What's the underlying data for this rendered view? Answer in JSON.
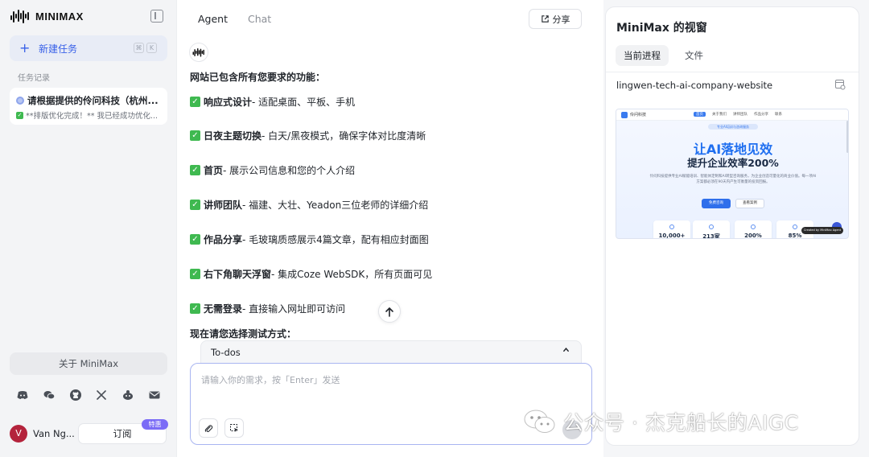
{
  "brand": {
    "name": "MINIMAX"
  },
  "sidebar": {
    "new_task": "新建任务",
    "shortcut_keys": [
      "⌘",
      "K"
    ],
    "section_title": "任务记录",
    "tasks": [
      {
        "title": "请根据提供的伶问科技（杭州...",
        "subtitle": "**排版优化完成！** 我已经成功优化..."
      }
    ],
    "about": "关于 MiniMax",
    "socials": [
      "discord-icon",
      "wechat-icon",
      "github-icon",
      "x-icon",
      "reddit-icon",
      "mail-icon"
    ],
    "user": {
      "initial": "V",
      "name": "Van Ng..."
    },
    "subscribe": "订阅",
    "badge": "特惠"
  },
  "main": {
    "tabs": [
      {
        "label": "Agent"
      },
      {
        "label": "Chat"
      }
    ],
    "share_label": "分享",
    "message": {
      "heading": "网站已包含所有您要求的功能：",
      "features": [
        {
          "title": "响应式设计",
          "desc": " - 适配桌面、平板、手机"
        },
        {
          "title": "日夜主题切换",
          "desc": " - 白天/黑夜模式，确保字体对比度清晰"
        },
        {
          "title": "首页",
          "desc": " - 展示公司信息和您的个人介绍"
        },
        {
          "title": "讲师团队",
          "desc": " - 福建、大壮、Yeadon三位老师的详细介绍"
        },
        {
          "title": "作品分享",
          "desc": " - 毛玻璃质感展示4篇文章，配有相应封面图"
        },
        {
          "title": "右下角聊天浮窗",
          "desc": " - 集成Coze WebSDK，所有页面可见"
        },
        {
          "title": "无需登录",
          "desc": " - 直接输入网址即可访问"
        }
      ],
      "test_heading": "现在请您选择测试方式："
    },
    "todos_label": "To-dos",
    "composer": {
      "placeholder": "请输入你的需求，按「Enter」发送",
      "value": ""
    }
  },
  "panel": {
    "title": "MiniMax 的视窗",
    "tabs": [
      {
        "label": "当前进程"
      },
      {
        "label": "文件"
      }
    ],
    "project_name": "lingwen-tech-ai-company-website",
    "preview": {
      "logo_text": "伶问科技",
      "nav_links": [
        "首页",
        "关于我们",
        "讲师团队",
        "作品分享",
        "联系"
      ],
      "pill": "专业AI培训与咨询服务",
      "headline": "让AI落地见效",
      "subheadline": "提升企业效率200%",
      "description": "伶问科技提供专业AI赋能培训、智能体定制和AI转型咨询服务，为企业创造可量化的商业价值。每一项AI方案都必须在90天内产生可衡量的投资回报。",
      "button_primary": "免费咨询",
      "button_secondary": "查看案例",
      "stats": [
        "10,000+",
        "213家",
        "200%",
        "85%"
      ],
      "chat_widget": "Created by MiniMax Agent"
    }
  },
  "watermark": {
    "text": "公众号 · 杰克船长的AIGC"
  },
  "colors": {
    "accent": "#3860e8",
    "success": "#3fb950",
    "badge": "#7b6cf6"
  }
}
